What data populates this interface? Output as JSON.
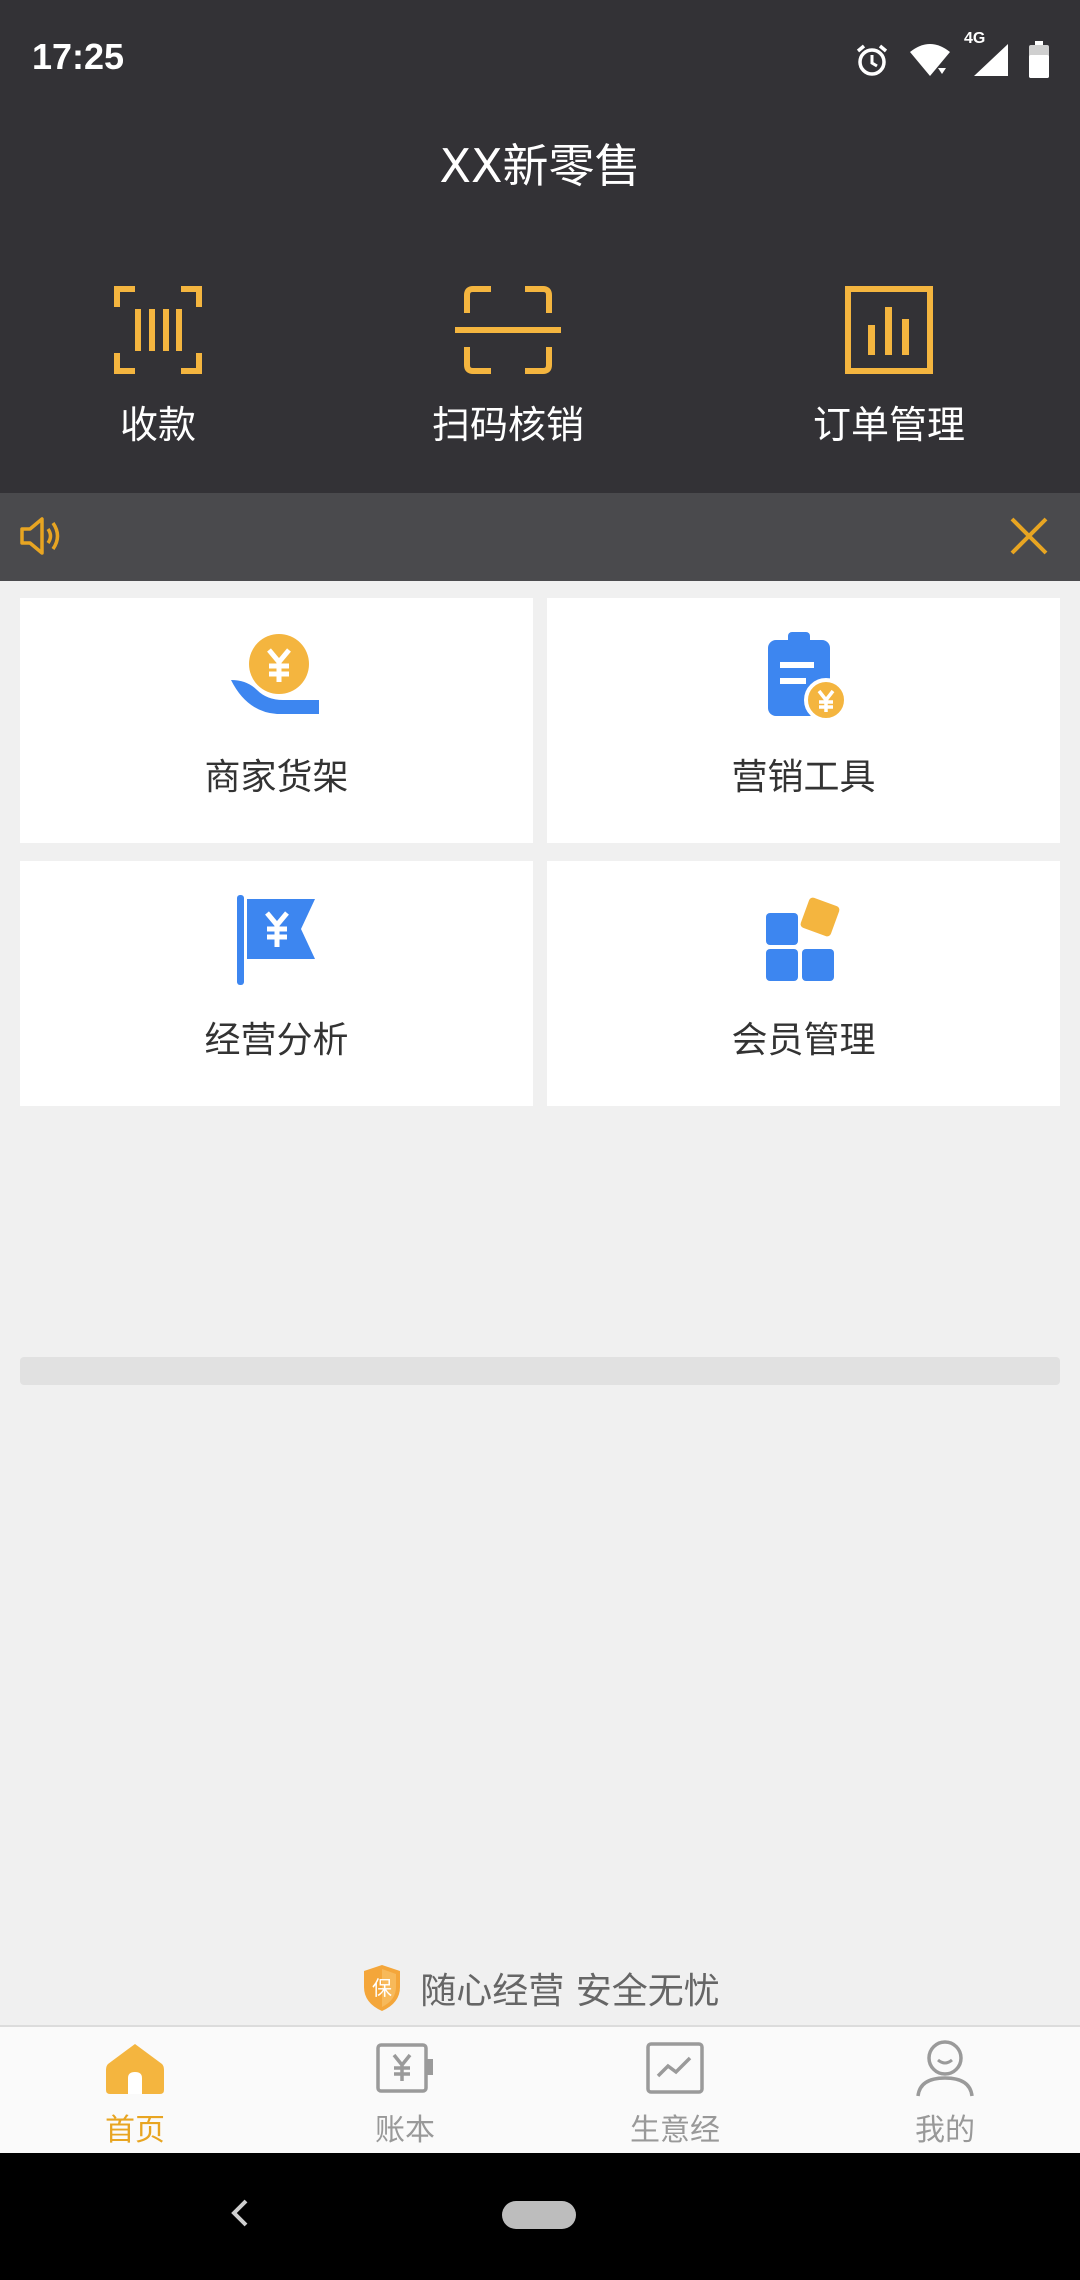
{
  "status_bar": {
    "time": "17:25",
    "network": "4G"
  },
  "header": {
    "title": "XX新零售"
  },
  "quick_actions": [
    {
      "label": "收款",
      "icon": "barcode-icon"
    },
    {
      "label": "扫码核销",
      "icon": "scan-icon"
    },
    {
      "label": "订单管理",
      "icon": "bar-chart-icon"
    }
  ],
  "notice": {
    "icon": "speaker-icon",
    "close_icon": "close-icon"
  },
  "cards": [
    {
      "label": "商家货架",
      "icon": "yuan-hand-icon"
    },
    {
      "label": "营销工具",
      "icon": "clipboard-yuan-icon"
    },
    {
      "label": "经营分析",
      "icon": "yuan-flag-icon"
    },
    {
      "label": "会员管理",
      "icon": "blocks-icon"
    }
  ],
  "slogan": {
    "badge": "保",
    "text": "随心经营 安全无忧"
  },
  "tabs": [
    {
      "label": "首页",
      "icon": "home-icon",
      "active": true
    },
    {
      "label": "账本",
      "icon": "ledger-icon",
      "active": false
    },
    {
      "label": "生意经",
      "icon": "trend-icon",
      "active": false
    },
    {
      "label": "我的",
      "icon": "profile-icon",
      "active": false
    }
  ],
  "colors": {
    "header_bg": "#333236",
    "accent": "#e8a522",
    "icon_blue": "#3d86f0",
    "icon_gold": "#f4b53f"
  }
}
